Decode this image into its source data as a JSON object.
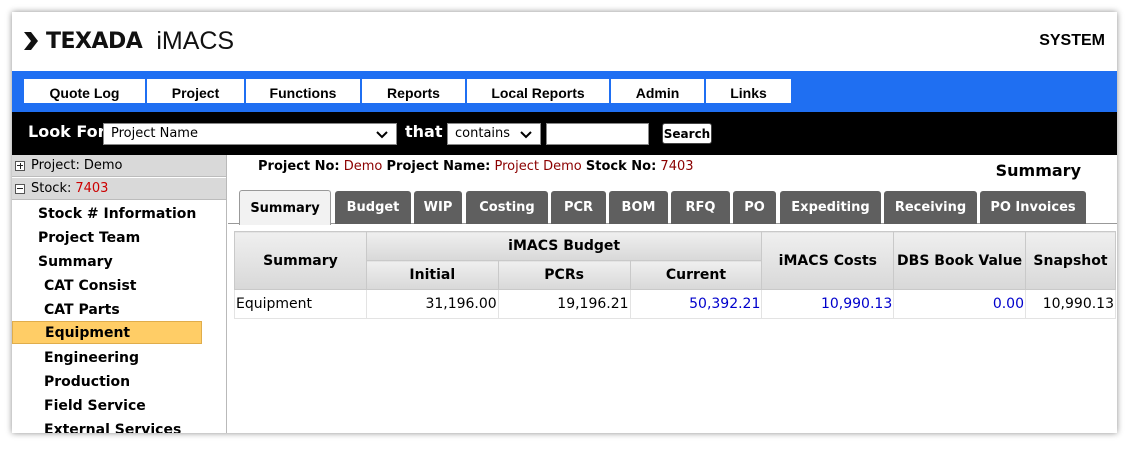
{
  "header": {
    "logo_text": "TEXADA",
    "app_name": "iMACS",
    "system_label": "SYSTEM"
  },
  "nav": {
    "items": [
      "Quote Log",
      "Project",
      "Functions",
      "Reports",
      "Local Reports",
      "Admin",
      "Links"
    ]
  },
  "lookbar": {
    "look_for_label": "Look For",
    "field_value": "Project Name",
    "that_label": "that",
    "operator_value": "contains",
    "search_text": "",
    "search_button": "Search"
  },
  "sidebar": {
    "project_label": "Project: ",
    "project_value": "Demo",
    "stock_label": "Stock: ",
    "stock_value": "7403",
    "items": [
      "Stock # Information",
      "Project Team",
      "Summary"
    ],
    "subitems": [
      "CAT Consist",
      "CAT Parts",
      "Equipment",
      "Engineering",
      "Production",
      "Field Service",
      "External Services"
    ],
    "active": "Equipment"
  },
  "main": {
    "project_no_label": "Project No:",
    "project_no_value": "Demo",
    "project_name_label": "Project Name:",
    "project_name_value": "Project Demo",
    "stock_no_label": "Stock No:",
    "stock_no_value": "7403",
    "page_title": "Summary",
    "tabs": [
      "Summary",
      "Budget",
      "WIP",
      "Costing",
      "PCR",
      "BOM",
      "RFQ",
      "PO",
      "Expediting",
      "Receiving",
      "PO Invoices"
    ],
    "active_tab": "Summary"
  },
  "table": {
    "col_summary": "Summary",
    "col_budget_group": "iMACS Budget",
    "col_initial": "Initial",
    "col_pcrs": "PCRs",
    "col_current": "Current",
    "col_costs": "iMACS Costs",
    "col_dbs": "DBS Book Value",
    "col_snapshot": "Snapshot",
    "rows": [
      {
        "summary": "Equipment",
        "initial": "31,196.00",
        "pcrs": "19,196.21",
        "current": "50,392.21",
        "costs": "10,990.13",
        "dbs": "0.00",
        "snapshot": "10,990.13"
      }
    ]
  },
  "colors": {
    "nav_bg": "#1f6ff2",
    "lookbar_bg": "#000000",
    "active_item": "#ffcd66",
    "tab_bg": "#5f5f5f",
    "link": "#0000cc"
  }
}
